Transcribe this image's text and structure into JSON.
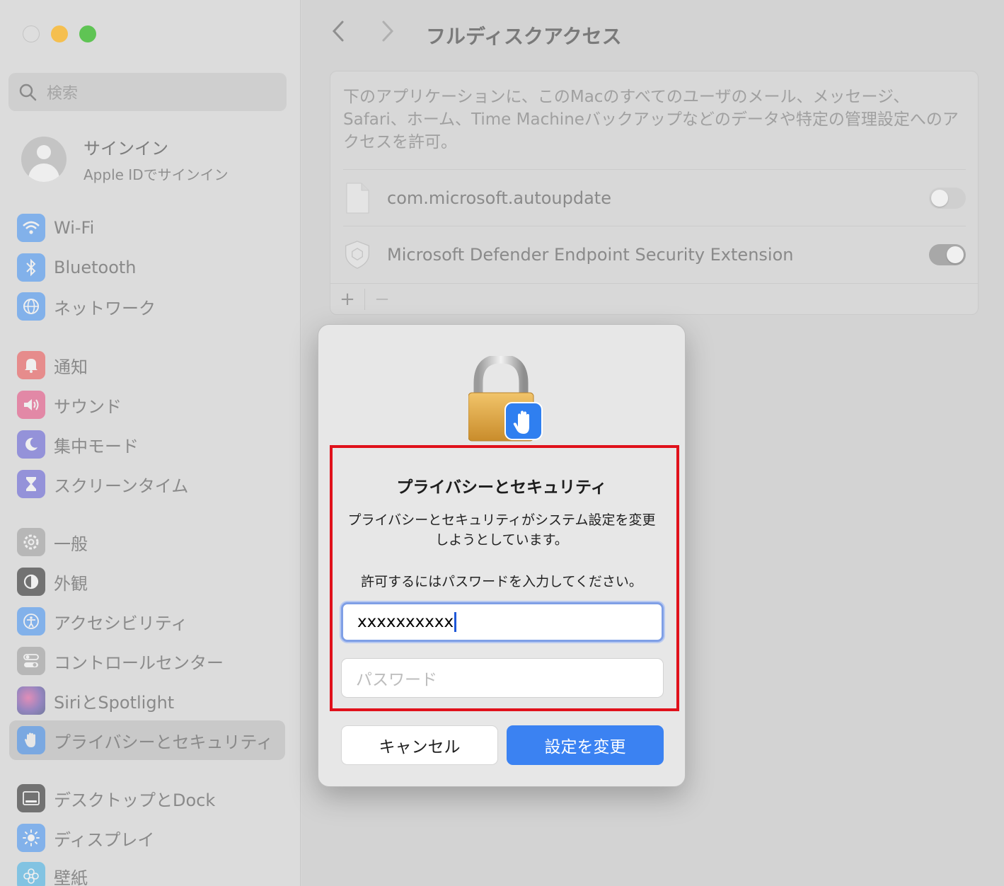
{
  "sidebar": {
    "search_placeholder": "検索",
    "account": {
      "title": "サインイン",
      "subtitle": "Apple IDでサインイン"
    },
    "items": [
      {
        "label": "Wi-Fi",
        "icon": "wifi-icon",
        "color": "#3a8ef6"
      },
      {
        "label": "Bluetooth",
        "icon": "bluetooth-icon",
        "color": "#3a8ef6"
      },
      {
        "label": "ネットワーク",
        "icon": "globe-icon",
        "color": "#3a8ef6"
      },
      {
        "label": "通知",
        "icon": "bell-icon",
        "color": "#ef4b4b"
      },
      {
        "label": "サウンド",
        "icon": "speaker-icon",
        "color": "#e8447a"
      },
      {
        "label": "集中モード",
        "icon": "moon-icon",
        "color": "#5b57d8"
      },
      {
        "label": "スクリーンタイム",
        "icon": "hourglass-icon",
        "color": "#5b57d8"
      },
      {
        "label": "一般",
        "icon": "gear-icon",
        "color": "#9a9a9a"
      },
      {
        "label": "外観",
        "icon": "appearance-icon",
        "color": "#1c1c1c"
      },
      {
        "label": "アクセシビリティ",
        "icon": "accessibility-icon",
        "color": "#3a8ef6"
      },
      {
        "label": "コントロールセンター",
        "icon": "switches-icon",
        "color": "#9a9a9a"
      },
      {
        "label": "SiriとSpotlight",
        "icon": "siri-icon",
        "color": "#5a3ea8"
      },
      {
        "label": "プライバシーとセキュリティ",
        "icon": "hand-icon",
        "color": "#3a8ef6"
      },
      {
        "label": "デスクトップとDock",
        "icon": "dock-icon",
        "color": "#1c1c1c"
      },
      {
        "label": "ディスプレイ",
        "icon": "sun-icon",
        "color": "#3a8ef6"
      },
      {
        "label": "壁紙",
        "icon": "flower-icon",
        "color": "#3ab0e8"
      }
    ]
  },
  "main": {
    "title": "フルディスクアクセス",
    "description": "下のアプリケーションに、このMacのすべてのユーザのメール、メッセージ、Safari、ホーム、Time Machineバックアップなどのデータや特定の管理設定へのアクセスを許可。",
    "apps": [
      {
        "name": "com.microsoft.autoupdate",
        "enabled": false
      },
      {
        "name": "Microsoft Defender Endpoint Security Extension",
        "enabled": true
      }
    ],
    "add_label": "+",
    "remove_label": "−"
  },
  "dialog": {
    "title": "プライバシーとセキュリティ",
    "message": "プライバシーとセキュリティがシステム設定を変更しようとしています。",
    "instruction": "許可するにはパスワードを入力してください。",
    "username_value": "xxxxxxxxxx",
    "password_placeholder": "パスワード",
    "cancel_label": "キャンセル",
    "confirm_label": "設定を変更",
    "highlight_color": "#e0111b"
  }
}
